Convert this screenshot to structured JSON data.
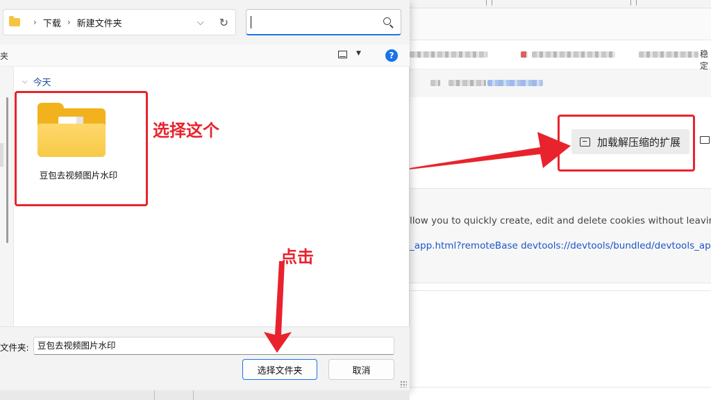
{
  "dialog": {
    "breadcrumb": [
      "下载",
      "新建文件夹"
    ],
    "search_placeholder": "",
    "cmd_left": "夹",
    "help": "?",
    "group": "今天",
    "folder_name": "豆包去视频图片水印",
    "footer": {
      "name_label": "文件夹:",
      "name_value": "豆包去视频图片水印",
      "select_button": "选择文件夹",
      "cancel_button": "取消"
    }
  },
  "browser": {
    "load_button": "加载解压缩的扩展",
    "description": "llow you to quickly create, edit and delete cookies without leaving y",
    "link": "_app.html?remoteBase devtools://devtools/bundled/devtools_app.htm",
    "bookmark_tail": "稳定"
  },
  "annotations": {
    "select_this": "选择这个",
    "click": "点击",
    "color": "#e8232d"
  },
  "colors": {
    "accent": "#1a73e8",
    "folder": "#f2b21e",
    "link": "#1a56c8"
  }
}
